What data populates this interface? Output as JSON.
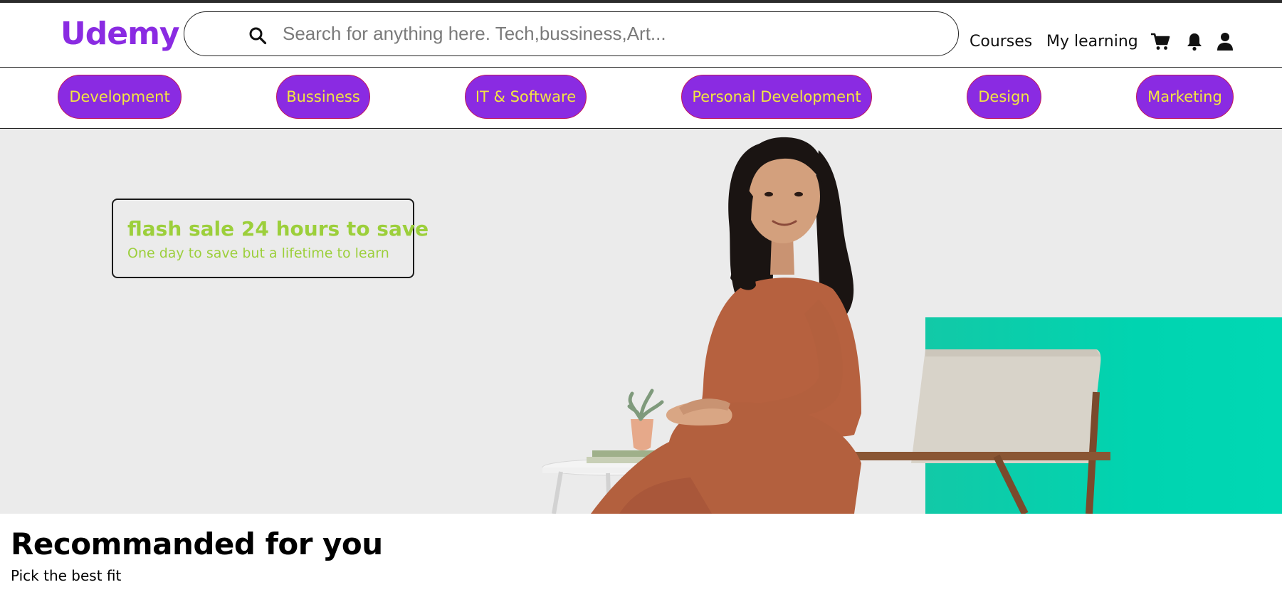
{
  "header": {
    "logo": "Udemy",
    "search": {
      "placeholder": "Search for anything here. Tech,bussiness,Art...",
      "icon": "search-icon"
    },
    "links": {
      "courses": "Courses",
      "my_learning": "My learning"
    },
    "icons": [
      "cart-icon",
      "bell-icon",
      "user-icon"
    ]
  },
  "categories": [
    {
      "label": "Development"
    },
    {
      "label": "Bussiness"
    },
    {
      "label": "IT & Software"
    },
    {
      "label": "Personal Development"
    },
    {
      "label": "Design"
    },
    {
      "label": "Marketing"
    }
  ],
  "hero": {
    "promo_title": "flash sale 24 hours to save",
    "promo_subtitle": "One day to save but a lifetime to learn"
  },
  "recommended": {
    "title": "Recommanded for you",
    "subtitle": "Pick the best fit"
  },
  "colors": {
    "brand": "#8a2be2",
    "pill_text": "#f2e641",
    "promo_text": "#9ccf3b",
    "accent_teal": "#00d4b0"
  }
}
